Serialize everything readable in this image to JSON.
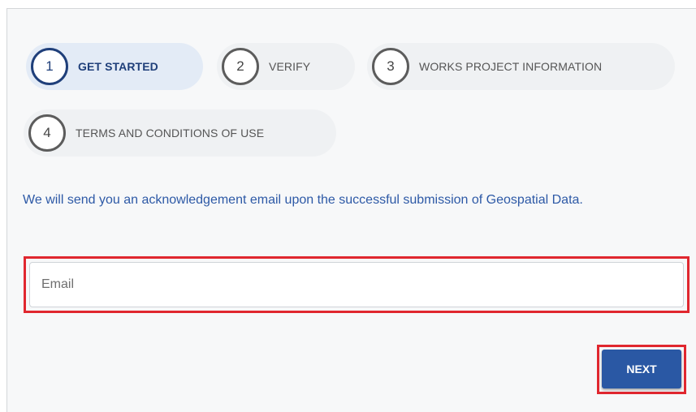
{
  "stepper": {
    "steps": [
      {
        "number": "1",
        "label": "GET STARTED",
        "state": "active"
      },
      {
        "number": "2",
        "label": "VERIFY",
        "state": "inactive"
      },
      {
        "number": "3",
        "label": "WORKS PROJECT INFORMATION",
        "state": "inactive"
      },
      {
        "number": "4",
        "label": "TERMS AND CONDITIONS OF USE",
        "state": "inactive"
      }
    ]
  },
  "form": {
    "info_text": "We will send you an acknowledgement email upon the successful submission of Geospatial Data.",
    "email": {
      "placeholder": "Email",
      "value": ""
    },
    "next_label": "NEXT"
  },
  "colors": {
    "accent": "#2a58a4",
    "active_step_bg": "#e3ebf6",
    "highlight": "#e0272f"
  }
}
